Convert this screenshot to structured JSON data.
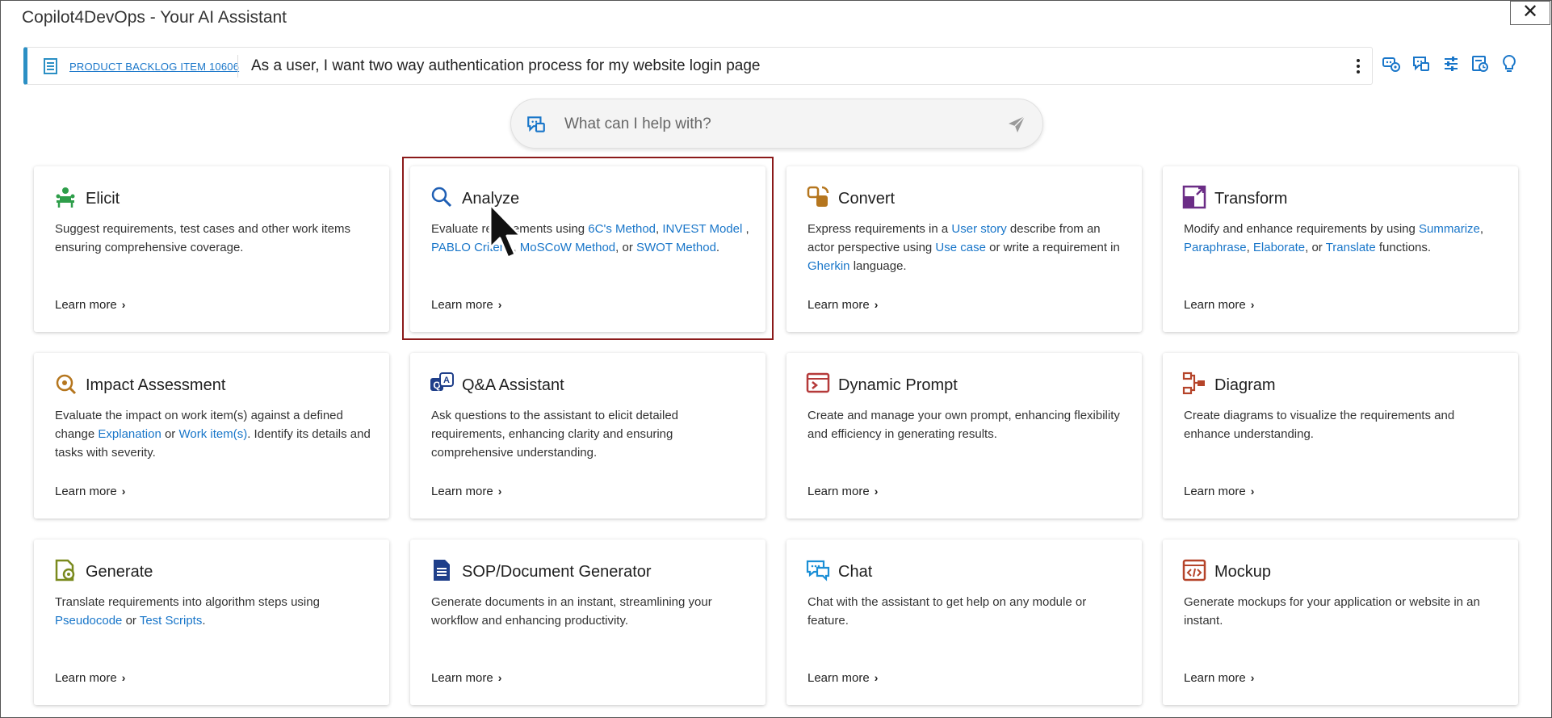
{
  "window": {
    "title": "Copilot4DevOps - Your AI Assistant",
    "close_label": "✕"
  },
  "work_item": {
    "link_text": "PRODUCT BACKLOG ITEM 10606",
    "title": "As a user, I want two way authentication process for my website login page"
  },
  "toolbar": {
    "icons": [
      "copilot-settings-icon",
      "chat-copilot-icon",
      "sliders-icon",
      "history-icon",
      "lightbulb-icon"
    ],
    "accent": "#1976c9"
  },
  "ask": {
    "placeholder": "What can I help with?"
  },
  "learn_more_label": "Learn more",
  "cards": [
    {
      "title": "Elicit",
      "icon": "elicit-icon",
      "desc": [
        {
          "t": "Suggest requirements, test cases and other work items ensuring comprehensive coverage."
        }
      ]
    },
    {
      "title": "Analyze",
      "icon": "magnifier-icon",
      "desc": [
        {
          "t": "Evaluate requirements using "
        },
        {
          "t": "6C's Method",
          "link": true
        },
        {
          "t": ", "
        },
        {
          "t": "INVEST Model",
          "link": true
        },
        {
          "t": " , "
        },
        {
          "t": "PABLO Criteria",
          "link": true
        },
        {
          "t": ", "
        },
        {
          "t": "MoSCoW Method",
          "link": true
        },
        {
          "t": ", or "
        },
        {
          "t": "SWOT Method",
          "link": true
        },
        {
          "t": "."
        }
      ]
    },
    {
      "title": "Convert",
      "icon": "convert-icon",
      "desc": [
        {
          "t": "Express requirements in a "
        },
        {
          "t": "User story",
          "link": true
        },
        {
          "t": "  describe from an actor perspective using "
        },
        {
          "t": "Use case",
          "link": true
        },
        {
          "t": "  or write a requirement in "
        },
        {
          "t": "Gherkin",
          "link": true
        },
        {
          "t": "  language."
        }
      ]
    },
    {
      "title": "Transform",
      "icon": "transform-icon",
      "desc": [
        {
          "t": "Modify and enhance requirements by using "
        },
        {
          "t": "Summarize",
          "link": true
        },
        {
          "t": ", "
        },
        {
          "t": "Paraphrase",
          "link": true
        },
        {
          "t": ", "
        },
        {
          "t": "Elaborate",
          "link": true
        },
        {
          "t": ", or "
        },
        {
          "t": "Translate",
          "link": true
        },
        {
          "t": "  functions."
        }
      ]
    },
    {
      "title": "Impact Assessment",
      "icon": "impact-icon",
      "desc": [
        {
          "t": "Evaluate the impact on work item(s) against a defined change "
        },
        {
          "t": "Explanation",
          "link": true
        },
        {
          "t": " or "
        },
        {
          "t": "Work item(s)",
          "link": true
        },
        {
          "t": ".  Identify its details and tasks with severity."
        }
      ]
    },
    {
      "title": "Q&A Assistant",
      "icon": "qa-icon",
      "desc": [
        {
          "t": "Ask questions to the assistant to elicit detailed requirements, enhancing clarity and ensuring comprehensive understanding."
        }
      ]
    },
    {
      "title": "Dynamic Prompt",
      "icon": "prompt-icon",
      "desc": [
        {
          "t": "Create and manage your own prompt, enhancing flexibility and efficiency in generating results."
        }
      ]
    },
    {
      "title": "Diagram",
      "icon": "diagram-icon",
      "desc": [
        {
          "t": "Create diagrams to visualize the requirements and enhance understanding."
        }
      ]
    },
    {
      "title": "Generate",
      "icon": "generate-icon",
      "desc": [
        {
          "t": "Translate requirements into algorithm steps using "
        },
        {
          "t": "Pseudocode",
          "link": true
        },
        {
          "t": " or "
        },
        {
          "t": "Test Scripts",
          "link": true
        },
        {
          "t": "."
        }
      ]
    },
    {
      "title": "SOP/Document Generator",
      "icon": "document-icon",
      "desc": [
        {
          "t": "Generate documents in an instant, streamlining your workflow and enhancing productivity."
        }
      ]
    },
    {
      "title": "Chat",
      "icon": "chat-icon",
      "desc": [
        {
          "t": "Chat with the assistant to get help on any module or feature."
        }
      ]
    },
    {
      "title": "Mockup",
      "icon": "mockup-icon",
      "desc": [
        {
          "t": "Generate mockups for your application or website in an instant."
        }
      ]
    }
  ]
}
